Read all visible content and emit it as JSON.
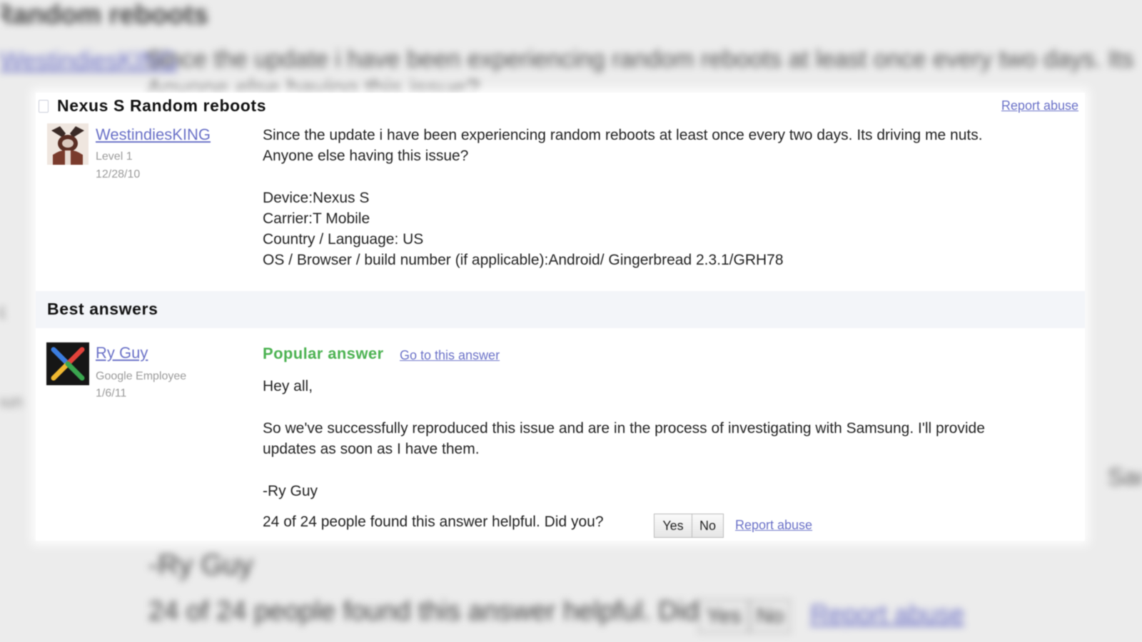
{
  "background": {
    "title": "Random reboots",
    "author": "WestindiesKING",
    "line1": "Since the update i have been experiencing random reboots at least once every two days. Its",
    "line2": "Anyone else having this issue?",
    "side_left": "k",
    "side_left2": "oun",
    "side_right": "Sam",
    "signature": "-Ry Guy",
    "helpful": "24 of 24 people found this answer helpful. Did you?",
    "yes": "Yes",
    "no": "No",
    "report": "Report abuse"
  },
  "thread": {
    "title": "Nexus S Random reboots",
    "report_label": "Report abuse",
    "author": "WestindiesKING",
    "level": "Level 1",
    "date": "12/28/10",
    "body": [
      "Since the update i have been experiencing random reboots at least once every two days. Its driving me nuts.",
      "Anyone else having this issue?",
      "Device:Nexus S",
      "Carrier:T Mobile",
      "Country / Language: US",
      "OS / Browser / build number (if applicable):Android/ Gingerbread 2.3.1/GRH78"
    ]
  },
  "best_answers": {
    "heading": "Best answers",
    "author": "Ry Guy",
    "role": "Google Employee",
    "date": "1/6/11",
    "badge": "Popular answer",
    "goto_label": "Go to this answer",
    "body": [
      "Hey all,",
      "So we've successfully reproduced this issue and are in the process of investigating with Samsung. I'll provide",
      "updates as soon as I have them.",
      "-Ry Guy"
    ],
    "helpful_text": "24 of 24 people found this answer helpful. Did you?",
    "yes_label": "Yes",
    "no_label": "No",
    "report_label": "Report abuse"
  },
  "colors": {
    "link": "#6970c7",
    "popular": "#4bb251",
    "best_bar": "#f3f5f9"
  }
}
